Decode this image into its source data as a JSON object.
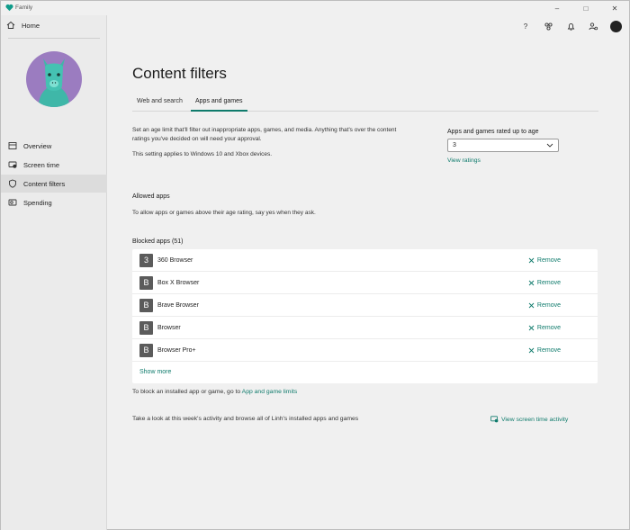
{
  "window": {
    "title": "Family",
    "controls": [
      "–",
      "□",
      "✕"
    ]
  },
  "sidebar": {
    "home_label": "Home",
    "items": [
      {
        "label": "Overview",
        "icon": "overview-icon"
      },
      {
        "label": "Screen time",
        "icon": "screen-time-icon"
      },
      {
        "label": "Content filters",
        "icon": "shield-icon",
        "active": true
      },
      {
        "label": "Spending",
        "icon": "spending-icon"
      }
    ]
  },
  "topbar": {
    "icons": [
      "help-icon",
      "family-group-icon",
      "bell-icon",
      "settings-people-icon",
      "profile-avatar"
    ],
    "help_glyph": "?"
  },
  "page": {
    "title": "Content filters",
    "tabs": [
      {
        "label": "Web and search",
        "selected": false
      },
      {
        "label": "Apps and games",
        "selected": true
      }
    ],
    "description": "Set an age limit that'll filter out inappropriate apps, games, and media. Anything that's over the content ratings you've decided on will need your approval.",
    "applies_to": "This setting applies to Windows 10 and Xbox devices.",
    "age_label": "Apps and games rated up to age",
    "age_value": "3",
    "view_ratings": "View ratings",
    "allowed_title": "Allowed apps",
    "allowed_desc": "To allow apps or games above their age rating, say yes when they ask.",
    "blocked_title": "Blocked apps (51)",
    "blocked_apps": [
      {
        "initial": "3",
        "name": "360 Browser"
      },
      {
        "initial": "B",
        "name": "Box X Browser"
      },
      {
        "initial": "B",
        "name": "Brave Browser"
      },
      {
        "initial": "B",
        "name": "Browser"
      },
      {
        "initial": "B",
        "name": "Browser Pro+"
      }
    ],
    "remove_label": "Remove",
    "show_more": "Show more",
    "block_note_prefix": "To block an installed app or game, go to ",
    "block_note_link": "App and game limits",
    "activity_note": "Take a look at this week's activity and browse all of Linh's installed apps and games",
    "screen_time_link": "View screen time activity"
  },
  "colors": {
    "accent": "#0f7b6c",
    "avatar_bg": "#9b7cc0",
    "llama": "#3fb7a8",
    "app_tile": "#5b5b5b"
  }
}
